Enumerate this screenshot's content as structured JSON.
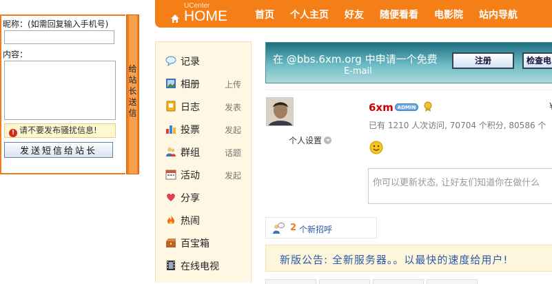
{
  "message_box": {
    "nickname_label": "昵称：(如需回复输入手机号)",
    "content_label": "内容：",
    "nickname_value": "",
    "content_value": "",
    "warning": "请不要发布骚扰信息!",
    "send_button": "发送短信给站长",
    "side_tab": "给站长送信"
  },
  "header": {
    "logo_small": "UCenter",
    "logo_big": "HOME",
    "nav": [
      "首页",
      "个人主页",
      "好友",
      "随便看看",
      "电影院",
      "站内导航"
    ]
  },
  "sidebar": {
    "items": [
      {
        "label": "记录",
        "action": "",
        "icon": "speech-bubble-icon"
      },
      {
        "label": "相册",
        "action": "上传",
        "icon": "photo-album-icon"
      },
      {
        "label": "日志",
        "action": "发表",
        "icon": "journal-icon"
      },
      {
        "label": "投票",
        "action": "发起",
        "icon": "bar-chart-icon"
      },
      {
        "label": "群组",
        "action": "话题",
        "icon": "group-icon"
      },
      {
        "label": "活动",
        "action": "发起",
        "icon": "calendar-icon"
      },
      {
        "label": "分享",
        "action": "",
        "icon": "heart-share-icon"
      },
      {
        "label": "热闹",
        "action": "",
        "icon": "fire-icon"
      },
      {
        "label": "百宝箱",
        "action": "",
        "icon": "treasure-box-icon"
      },
      {
        "label": "在线电视",
        "action": "",
        "icon": "film-icon"
      }
    ]
  },
  "banner": {
    "text": "在 @bbs.6xm.org 中申请一个免费",
    "text2": "E-mail",
    "register_button": "注册",
    "check_button": "检查电"
  },
  "profile": {
    "username": "6xm",
    "badge": "ADMIN",
    "settings_label": "个人设置",
    "stats": "已有 1210 人次访问, 70704 个积分, 80586 个",
    "status_placeholder": "你可以更新状态, 让好友们知道你在做什么",
    "right_cut": "¥"
  },
  "greetings": {
    "count": "2",
    "label": "个新招呼"
  },
  "notice": {
    "text": "新版公告: 全新服务器。。以最快的速度给用户!"
  },
  "colors": {
    "accent": "#f57f17",
    "sidebar_bg": "#fdf7e3",
    "link": "#2a5aa8",
    "username": "#cc0000"
  }
}
